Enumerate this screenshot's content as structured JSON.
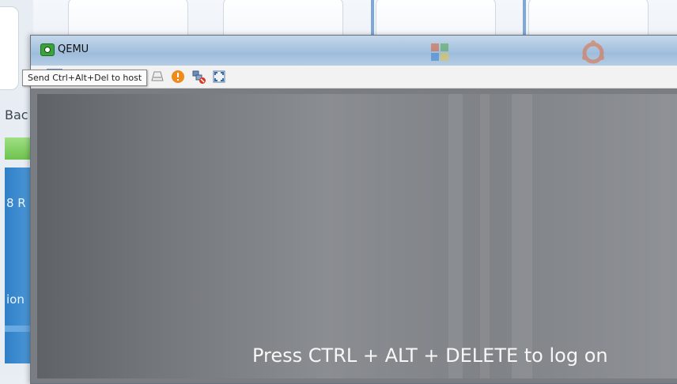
{
  "background": {
    "left_texts": [
      "Bac",
      "8 R",
      "ion"
    ]
  },
  "window": {
    "title": "QEMU"
  },
  "toolbar": {
    "buttons": [
      {
        "icon": "send-ctrl-alt-del-icon"
      },
      {
        "icon": "windows-icon"
      },
      {
        "icon": "tools-icon"
      },
      {
        "icon": "refresh-icon"
      },
      {
        "icon": "windows-logo-icon"
      },
      {
        "icon": "keyboard-icon"
      },
      {
        "icon": "warning-icon"
      },
      {
        "icon": "disconnect-icon"
      },
      {
        "icon": "fullscreen-icon"
      }
    ],
    "tooltip": "Send Ctrl+Alt+Del to host"
  },
  "vm_screen": {
    "message": "Press CTRL + ALT + DELETE to log on"
  },
  "colors": {
    "title_bar": "#b4cde5",
    "toolbar_bg": "#f2f2f2",
    "screen_gray": "#7f8286"
  }
}
